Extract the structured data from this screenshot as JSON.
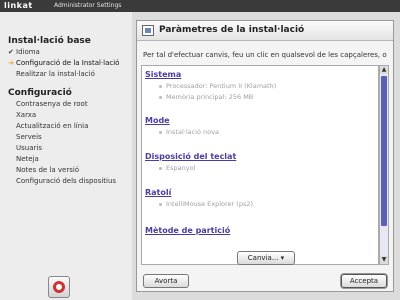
{
  "topbar": {
    "logo": "linkat",
    "title": "Administrator Settings"
  },
  "sidebar": {
    "sections": [
      {
        "title": "Instal·lació base",
        "items": [
          {
            "label": "Idioma",
            "state": "done"
          },
          {
            "label": "Configuració de la Instal·lació",
            "state": "active"
          },
          {
            "label": "Realitzar la instal·lació",
            "state": "pending"
          }
        ]
      },
      {
        "title": "Configuració",
        "items": [
          {
            "label": "Contrasenya de root"
          },
          {
            "label": "Xarxa"
          },
          {
            "label": "Actualització en línia"
          },
          {
            "label": "Serveis"
          },
          {
            "label": "Usuaris"
          },
          {
            "label": "Neteja"
          },
          {
            "label": "Notes de la versió"
          },
          {
            "label": "Configuració dels dispositius"
          }
        ]
      }
    ]
  },
  "panel": {
    "title": "Paràmetres de la instal·lació",
    "instructions": "Per tal d'efectuar canvis, feu un clic en qualsevol de les capçaleres, o",
    "categories": [
      {
        "title": "Sistema",
        "items": [
          "Processador: Pentium II (Klamath)",
          "Memòria principal: 256 MB"
        ]
      },
      {
        "title": "Mode",
        "items": [
          "Instal·lació nova"
        ]
      },
      {
        "title": "Disposició del teclat",
        "items": [
          "Espanyol"
        ]
      },
      {
        "title": "Ratolí",
        "items": [
          "IntelliMouse Explorer (ps2)"
        ]
      },
      {
        "title": "Mètode de partició",
        "items": []
      }
    ],
    "change_button": "Canvia...",
    "abort_button": "Avorta",
    "accept_button": "Accepta"
  },
  "colors": {
    "accent": "#f09a1a",
    "link": "#4a3ca0",
    "scroll_thumb": "#5a5fb2"
  }
}
